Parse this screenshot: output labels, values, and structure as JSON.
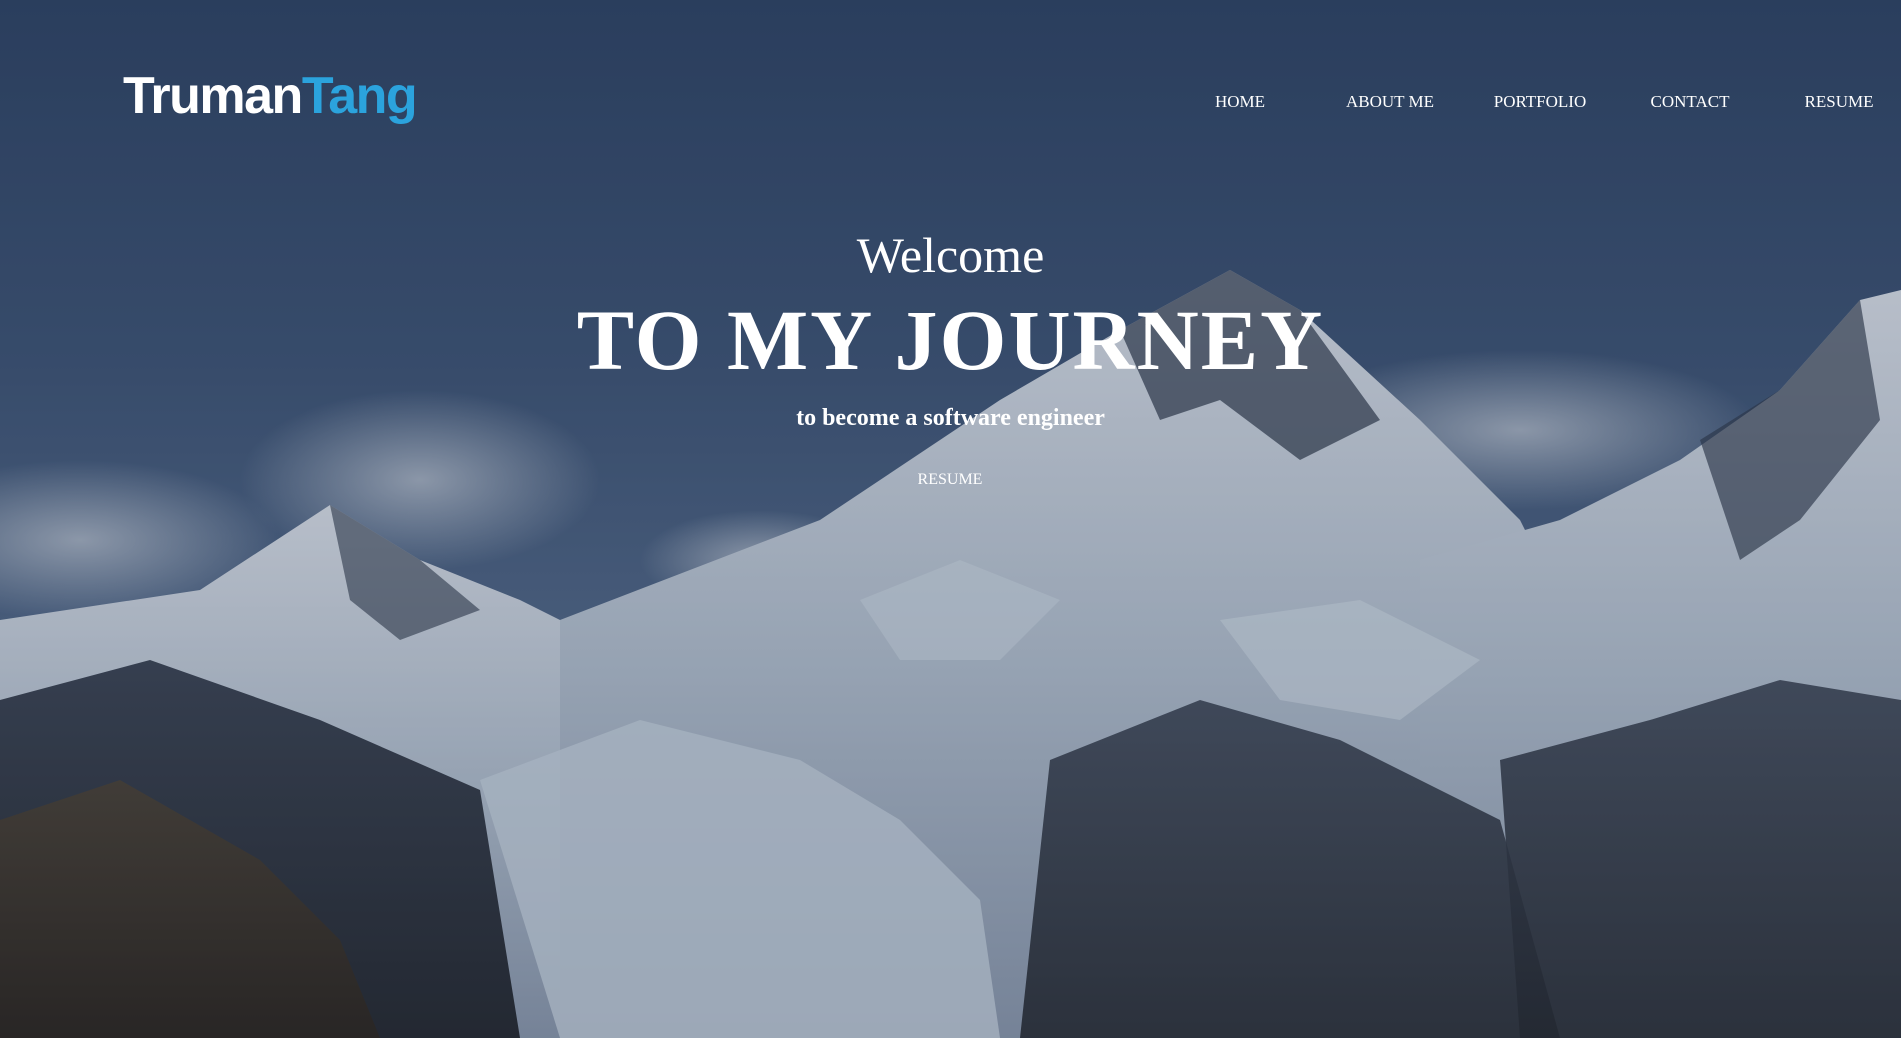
{
  "header": {
    "logo": {
      "first": "Truman",
      "last": "Tang"
    },
    "nav": {
      "home": "HOME",
      "about": "ABOUT ME",
      "portfolio": "PORTFOLIO",
      "contact": "CONTACT",
      "resume": "RESUME"
    }
  },
  "hero": {
    "welcome": "Welcome",
    "headline": "TO MY JOURNEY",
    "subtitle": "to become a software engineer",
    "cta_label": "RESUME",
    "background": "snowy-mountain-range-photo"
  },
  "colors": {
    "logo_accent": "#2ba3dd",
    "text": "#ffffff",
    "sky": "#3a5275"
  }
}
